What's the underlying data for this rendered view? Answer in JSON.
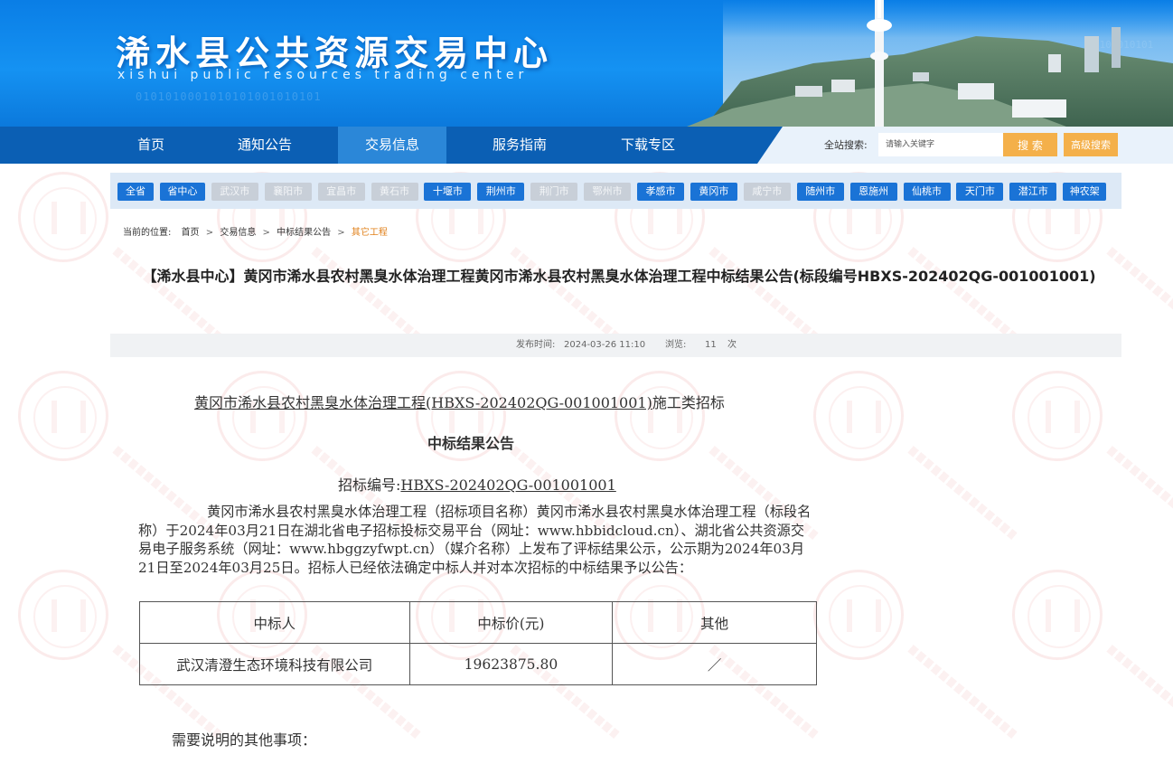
{
  "header": {
    "title": "浠水县公共资源交易中心",
    "subtitle": "xishui public resources trading center"
  },
  "nav": {
    "items": [
      "首页",
      "通知公告",
      "交易信息",
      "服务指南",
      "下载专区"
    ],
    "active_index": 2,
    "search_label": "全站搜索:",
    "search_placeholder": "请输入关键字",
    "search_button": "搜 索",
    "advanced_button": "高级搜索"
  },
  "regions": [
    {
      "label": "全省",
      "enabled": true
    },
    {
      "label": "省中心",
      "enabled": true
    },
    {
      "label": "武汉市",
      "enabled": false
    },
    {
      "label": "襄阳市",
      "enabled": false
    },
    {
      "label": "宜昌市",
      "enabled": false
    },
    {
      "label": "黄石市",
      "enabled": false
    },
    {
      "label": "十堰市",
      "enabled": true
    },
    {
      "label": "荆州市",
      "enabled": true
    },
    {
      "label": "荆门市",
      "enabled": false
    },
    {
      "label": "鄂州市",
      "enabled": false
    },
    {
      "label": "孝感市",
      "enabled": true
    },
    {
      "label": "黄冈市",
      "enabled": true
    },
    {
      "label": "咸宁市",
      "enabled": false
    },
    {
      "label": "随州市",
      "enabled": true
    },
    {
      "label": "恩施州",
      "enabled": true
    },
    {
      "label": "仙桃市",
      "enabled": true
    },
    {
      "label": "天门市",
      "enabled": true
    },
    {
      "label": "潜江市",
      "enabled": true
    },
    {
      "label": "神农架",
      "enabled": true
    }
  ],
  "breadcrumb": {
    "prefix": "当前的位置:",
    "items": [
      "首页",
      "交易信息",
      "中标结果公告",
      "其它工程"
    ],
    "separator": ">"
  },
  "article": {
    "title": "【浠水县中心】黄冈市浠水县农村黑臭水体治理工程黄冈市浠水县农村黑臭水体治理工程中标结果公告(标段编号HBXS-202402QG-001001001)",
    "publish_label": "发布时间:",
    "publish_time": "2024-03-26 11:10",
    "views_label": "浏览:",
    "views": "11",
    "views_unit": "次"
  },
  "doc": {
    "project_line_underlined": "黄冈市浠水县农村黑臭水体治理工程(HBXS-202402QG-001001001)",
    "project_line_suffix": "施工类招标",
    "heading": "中标结果公告",
    "code_label": "招标编号:",
    "code_value": "HBXS-202402QG-001001001",
    "paragraph": "黄冈市浠水县农村黑臭水体治理工程（招标项目名称）黄冈市浠水县农村黑臭水体治理工程（标段名称）于2024年03月21日在湖北省电子招标投标交易平台（网址：www.hbbidcloud.cn）、湖北省公共资源交易电子服务系统（网址：www.hbggzyfwpt.cn）（媒介名称）上发布了评标结果公示，公示期为2024年03月21日至2024年03月25日。招标人已经依法确定中标人并对本次招标的中标结果予以公告：",
    "table": {
      "headers": [
        "中标人",
        "中标价(元)",
        "其他"
      ],
      "rows": [
        [
          "武汉清澄生态环境科技有限公司",
          "19623875.80",
          "／"
        ]
      ]
    },
    "note": "需要说明的其他事项："
  },
  "colors": {
    "header_blue": "#1592f2",
    "nav_blue": "#0b5fb4",
    "nav_active": "#2b87d8",
    "region_on": "#1a73d6",
    "region_off": "#c8cfd8",
    "search_button": "#f4b04a",
    "breadcrumb_current": "#e0801a"
  }
}
